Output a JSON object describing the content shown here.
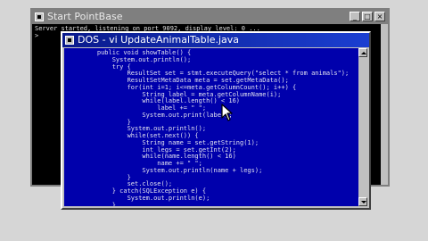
{
  "pointbase_window": {
    "title": "Start PointBase",
    "console_lines": [
      "Server started, listening on port 9092, display level: 0 ...",
      ">"
    ]
  },
  "dos_window": {
    "title": "DOS - vi UpdateAnimalTable.java",
    "code_lines": [
      "    public void showTable() {",
      "        System.out.println();",
      "        try {",
      "            ResultSet set = stmt.executeQuery(\"select * from animals\");",
      "            ResultSetMetaData meta = set.getMetaData();",
      "            for(int i=1; i<=meta.getColumnCount(); i++) {",
      "                String label = meta.getColumnName(i);",
      "                while(label.length() < 16)",
      "                    label += \" \";",
      "                System.out.print(label);",
      "            }",
      "            System.out.println();",
      "            while(set.next()) {",
      "                String name = set.getString(1);",
      "                int legs = set.getInt(2);",
      "                while(name.length() < 16)",
      "                    name += \" \";",
      "                System.out.println(name + legs);",
      "            }",
      "            set.close();",
      "        } catch(SQLException e) {",
      "            System.out.println(e);",
      "        }"
    ]
  },
  "window_buttons": {
    "minimize": "_",
    "maximize": "□",
    "close": "×"
  },
  "icons": [
    "console-app-icon",
    "dos-app-icon",
    "mouse-pointer-icon"
  ]
}
